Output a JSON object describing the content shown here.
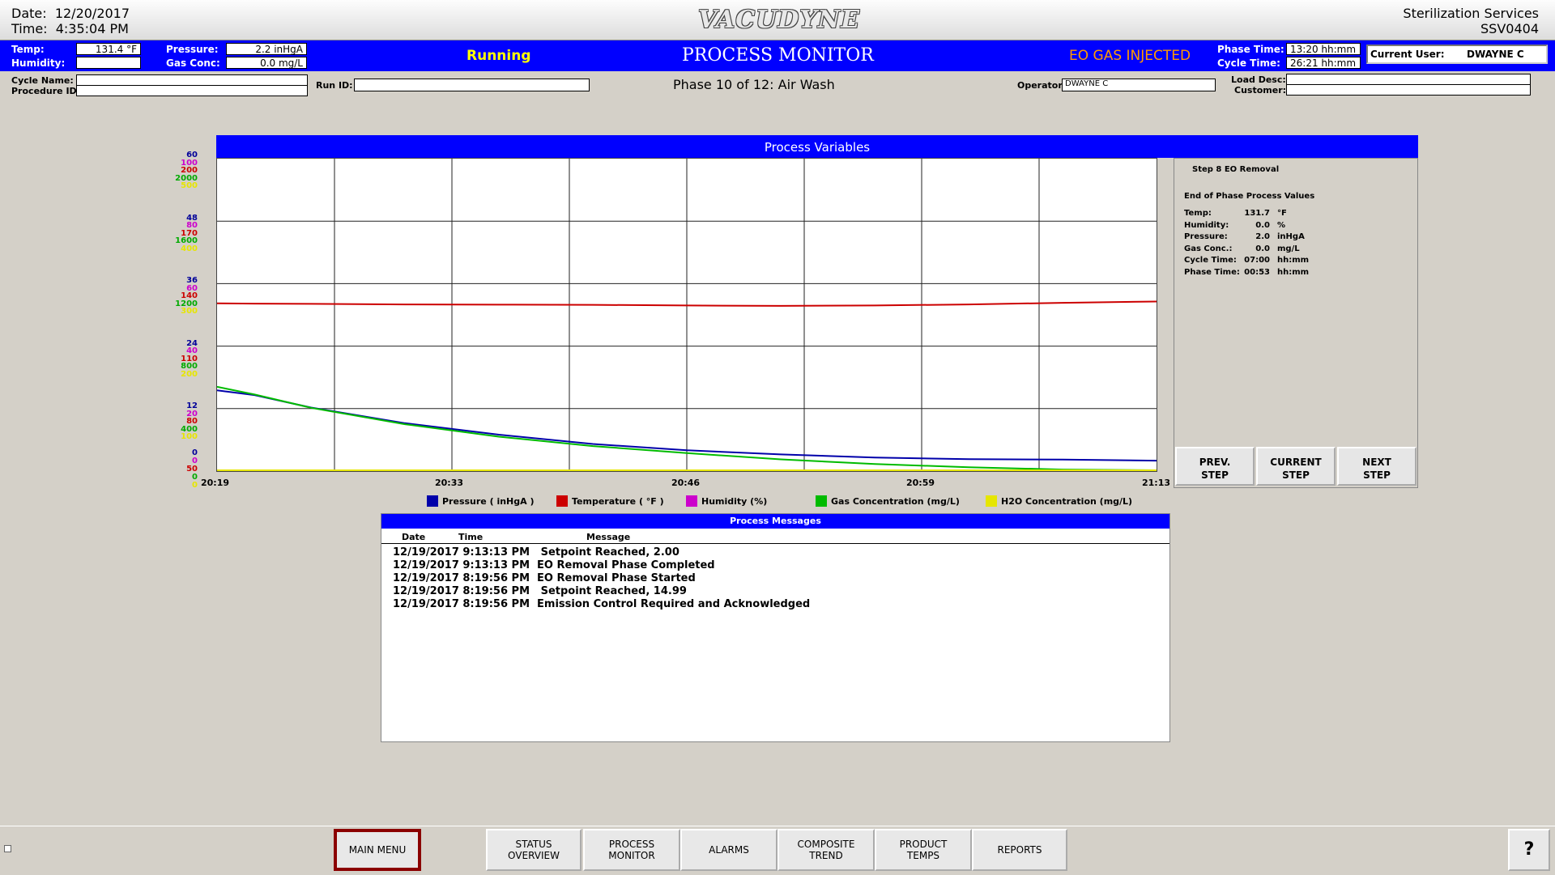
{
  "header": {
    "date_label": "Date:",
    "date": "12/20/2017",
    "time_label": "Time:",
    "time": "4:35:04 PM",
    "logo": "VACUDYNE",
    "company": "Sterilization Services",
    "system_id": "SSV0404"
  },
  "status": {
    "temp_label": "Temp:",
    "temp": "131.4 °F",
    "humidity_label": "Humidity:",
    "humidity": "",
    "pressure_label": "Pressure:",
    "pressure": "2.2 inHgA",
    "gas_label": "Gas Conc:",
    "gas": "0.0 mg/L",
    "state": "Running",
    "screen_title": "PROCESS MONITOR",
    "alert": "EO GAS INJECTED",
    "phase_time_label": "Phase Time:",
    "phase_time": "13:20 hh:mm",
    "cycle_time_label": "Cycle Time:",
    "cycle_time": "26:21 hh:mm",
    "user_label": "Current User:",
    "user": "DWAYNE C"
  },
  "info": {
    "cycle_name_label": "Cycle Name:",
    "procedure_label": "Procedure ID:",
    "run_id_label": "Run ID:",
    "phase": "Phase 10 of 12:  Air Wash",
    "operator_label": "Operator:",
    "operator": "DWAYNE C",
    "load_desc_label": "Load Desc:",
    "customer_label": "Customer:"
  },
  "side_panel": {
    "step": "Step 8 EO Removal",
    "heading": "End of Phase Process Values",
    "rows": [
      {
        "label": "Temp:",
        "value": "131.7",
        "unit": "°F"
      },
      {
        "label": "Humidity:",
        "value": "0.0",
        "unit": "%"
      },
      {
        "label": "Pressure:",
        "value": "2.0",
        "unit": "inHgA"
      },
      {
        "label": "Gas Conc.:",
        "value": "0.0",
        "unit": "mg/L"
      },
      {
        "label": "Cycle Time:",
        "value": "07:00",
        "unit": "hh:mm"
      },
      {
        "label": "Phase Time:",
        "value": "00:53",
        "unit": "hh:mm"
      }
    ],
    "prev_btn": "PREV.\nSTEP",
    "current_btn": "CURRENT\nSTEP",
    "next_btn": "NEXT\nSTEP"
  },
  "chart_data": {
    "type": "line",
    "title": "Process Variables",
    "xlabel": "",
    "ylabel": "",
    "x_ticks": [
      "20:19",
      "20:33",
      "20:46",
      "20:59",
      "21:13"
    ],
    "y_axes": [
      {
        "name": "Pressure",
        "color": "#000099",
        "ticks": [
          "0",
          "12",
          "24",
          "36",
          "48",
          "60"
        ],
        "ylim": [
          0,
          60
        ]
      },
      {
        "name": "Humidity",
        "color": "#cc00cc",
        "ticks": [
          "0",
          "20",
          "40",
          "60",
          "80",
          "100"
        ],
        "ylim": [
          0,
          100
        ]
      },
      {
        "name": "Temperature",
        "color": "#cc0000",
        "ticks": [
          "50",
          "80",
          "110",
          "140",
          "170",
          "200"
        ],
        "ylim": [
          50,
          200
        ]
      },
      {
        "name": "Gas Concentration",
        "color": "#00aa00",
        "ticks": [
          "0",
          "400",
          "800",
          "1200",
          "1600",
          "2000"
        ],
        "ylim": [
          0,
          2000
        ]
      },
      {
        "name": "H2O Concentration",
        "color": "#e6e600",
        "ticks": [
          "0",
          "100",
          "200",
          "300",
          "400",
          "500"
        ],
        "ylim": [
          0,
          500
        ]
      }
    ],
    "x": [
      0,
      0.04,
      0.1,
      0.2,
      0.3,
      0.4,
      0.5,
      0.6,
      0.7,
      0.8,
      0.9,
      1.0
    ],
    "series": [
      {
        "name": "Pressure ( inHgA )",
        "color": "#0000aa",
        "values": [
          15.5,
          14.6,
          12.2,
          9.2,
          7.0,
          5.2,
          4.0,
          3.2,
          2.6,
          2.3,
          2.2,
          2.0
        ]
      },
      {
        "name": "Temperature ( °F )",
        "color": "#cc0000",
        "values": [
          130.5,
          130.4,
          130.3,
          130.0,
          129.9,
          129.8,
          129.5,
          129.3,
          129.5,
          130.0,
          130.8,
          131.4
        ]
      },
      {
        "name": "Humidity (%)",
        "color": "#cc00cc",
        "values": [
          0,
          0,
          0,
          0,
          0,
          0,
          0,
          0,
          0,
          0,
          0,
          0
        ]
      },
      {
        "name": "Gas Concentration (mg/L)",
        "color": "#00bb00",
        "values": [
          540,
          490,
          405,
          300,
          220,
          160,
          115,
          75,
          45,
          25,
          10,
          0
        ]
      },
      {
        "name": "H2O Concentration (mg/L)",
        "color": "#e6e600",
        "values": [
          0,
          0,
          0,
          0,
          0,
          0,
          0,
          0,
          0,
          0,
          0,
          0
        ]
      }
    ]
  },
  "messages": {
    "title": "Process Messages",
    "columns": [
      "Date",
      "Time",
      "Message"
    ],
    "rows": [
      "12/19/2017 9:13:13 PM   Setpoint Reached, 2.00",
      "12/19/2017 9:13:13 PM  EO Removal Phase Completed",
      "12/19/2017 8:19:56 PM  EO Removal Phase Started",
      "12/19/2017 8:19:56 PM   Setpoint Reached, 14.99",
      "12/19/2017 8:19:56 PM  Emission Control Required and Acknowledged"
    ]
  },
  "nav": {
    "main_menu": "MAIN MENU",
    "status_overview": "STATUS\nOVERVIEW",
    "process_monitor": "PROCESS\nMONITOR",
    "alarms": "ALARMS",
    "composite_trend": "COMPOSITE\nTREND",
    "product_temps": "PRODUCT\nTEMPS",
    "reports": "REPORTS",
    "help": "?"
  }
}
